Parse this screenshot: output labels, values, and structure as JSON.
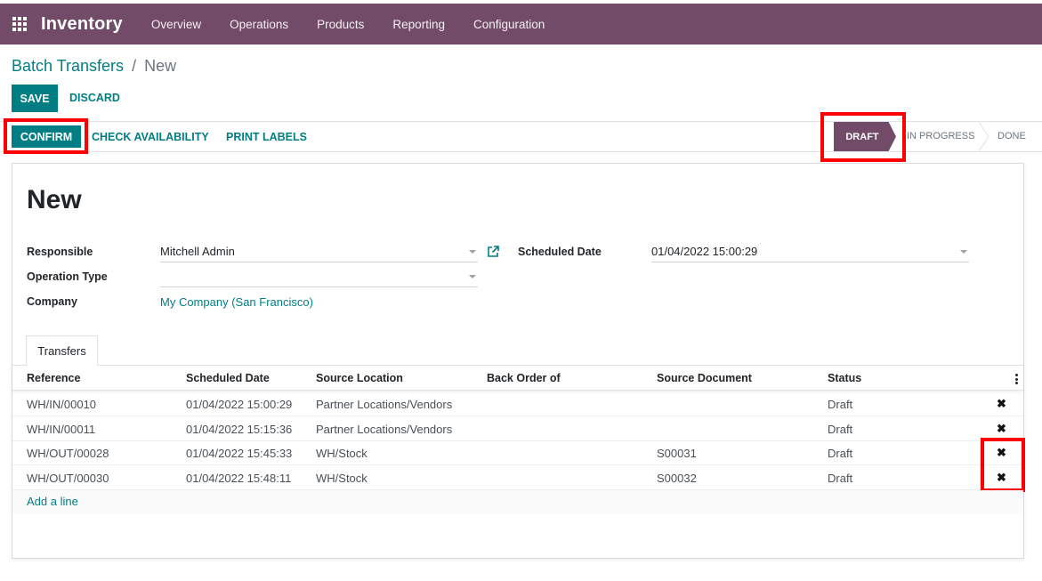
{
  "topbar": {
    "app_icon": "apps-grid-icon",
    "app_title": "Inventory",
    "menu": [
      "Overview",
      "Operations",
      "Products",
      "Reporting",
      "Configuration"
    ]
  },
  "breadcrumb": {
    "parent": "Batch Transfers",
    "separator": "/",
    "current": "New"
  },
  "actions": {
    "save": "SAVE",
    "discard": "DISCARD"
  },
  "header_buttons": {
    "confirm": "CONFIRM",
    "check_availability": "CHECK AVAILABILITY",
    "print_labels": "PRINT LABELS"
  },
  "stages": {
    "draft": "DRAFT",
    "in_progress": "IN PROGRESS",
    "done": "DONE",
    "active": "DRAFT"
  },
  "form": {
    "title": "New",
    "responsible_label": "Responsible",
    "responsible_value": "Mitchell Admin",
    "operation_type_label": "Operation Type",
    "operation_type_value": "",
    "company_label": "Company",
    "company_value": "My Company (San Francisco)",
    "scheduled_date_label": "Scheduled Date",
    "scheduled_date_value": "01/04/2022 15:00:29"
  },
  "tabs": [
    "Transfers"
  ],
  "table": {
    "columns": [
      "Reference",
      "Scheduled Date",
      "Source Location",
      "Back Order of",
      "Source Document",
      "Status"
    ],
    "rows": [
      {
        "reference": "WH/IN/00010",
        "scheduled": "01/04/2022 15:00:29",
        "source": "Partner Locations/Vendors",
        "backorder": "",
        "document": "",
        "status": "Draft",
        "delete": "✖"
      },
      {
        "reference": "WH/IN/00011",
        "scheduled": "01/04/2022 15:15:36",
        "source": "Partner Locations/Vendors",
        "backorder": "",
        "document": "",
        "status": "Draft",
        "delete": "✖"
      },
      {
        "reference": "WH/OUT/00028",
        "scheduled": "01/04/2022 15:45:33",
        "source": "WH/Stock",
        "backorder": "",
        "document": "S00031",
        "status": "Draft",
        "delete": "✖"
      },
      {
        "reference": "WH/OUT/00030",
        "scheduled": "01/04/2022 15:48:11",
        "source": "WH/Stock",
        "backorder": "",
        "document": "S00032",
        "status": "Draft",
        "delete": "✖"
      }
    ],
    "add_line": "Add a line"
  },
  "colors": {
    "brand": "#714b67",
    "accent": "#017e84",
    "highlight": "#ff0000"
  }
}
